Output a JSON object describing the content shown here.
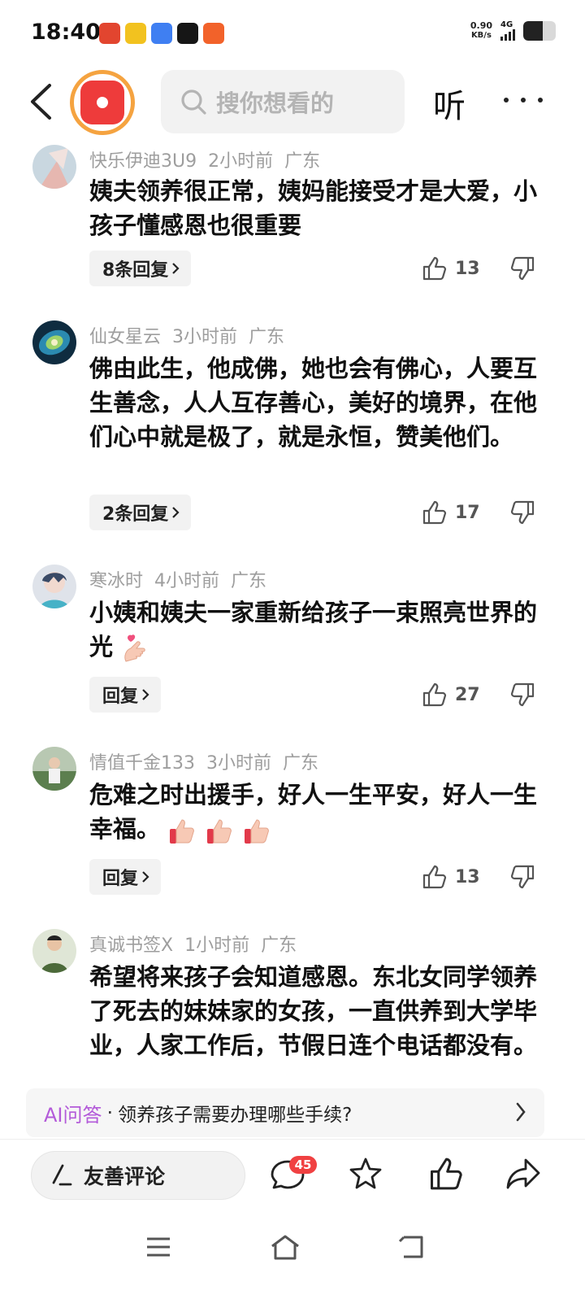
{
  "status_bar": {
    "time": "18:40",
    "net_speed_value": "0.90",
    "net_speed_unit": "KB/s",
    "network_type": "4G",
    "battery_level": 0.6,
    "app_icons": [
      "redpacket-app-icon",
      "hand-app-icon",
      "feather-app-icon",
      "tiktok-app-icon",
      "taobao-app-icon"
    ]
  },
  "header": {
    "search_placeholder": "搜你想看的",
    "listen_label": "听"
  },
  "comments": [
    {
      "user": "快乐伊迪3U9",
      "time": "2小时前",
      "location": "广东",
      "text": "姨夫领养很正常，姨妈能接受才是大爱，小孩子懂感恩也很重要",
      "reply_label": "8条回复",
      "likes": "13",
      "avatar_color": "#c9d7e0"
    },
    {
      "user": "仙女星云",
      "time": "3小时前",
      "location": "广东",
      "text": "佛由此生，他成佛，她也会有佛心，人要互生善念，人人互存善心，美好的境界，在他们心中就是极了，就是永恒，赞美他们。",
      "reply_label": "2条回复",
      "likes": "17",
      "avatar_color": "#1b4d6b"
    },
    {
      "user": "寒冰时",
      "time": "4小时前",
      "location": "广东",
      "text": "小姨和姨夫一家重新给孩子一束照亮世界的光",
      "reply_label": "回复",
      "likes": "27",
      "avatar_color": "#8a93a6"
    },
    {
      "user": "情值千金133",
      "time": "3小时前",
      "location": "广东",
      "text": "危难之时出援手，好人一生平安，好人一生幸福。",
      "reply_label": "回复",
      "likes": "13",
      "avatar_color": "#6f8a6a"
    },
    {
      "user": "真诚书签X",
      "time": "1小时前",
      "location": "广东",
      "text": "希望将来孩子会知道感恩。东北女同学领养了死去的妹妹家的女孩，一直供养到大学毕业，人家工作后，节假日连个电话都没有。",
      "avatar_color": "#4c6a3a"
    }
  ],
  "ai_bar": {
    "label": "AI问答",
    "dot": "·",
    "question": "领养孩子需要办理哪些手续?"
  },
  "bottom_bar": {
    "write_label": "友善评论",
    "comment_count": "45"
  },
  "colors": {
    "accent_red": "#f04142",
    "logo_ring": "#f5a340",
    "ai_purple": "#b35ad9"
  }
}
